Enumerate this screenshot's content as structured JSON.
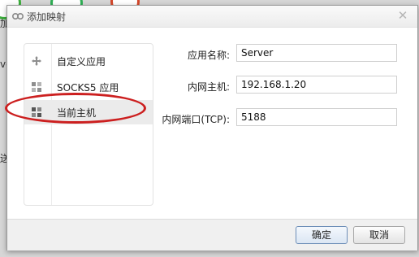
{
  "background": {
    "edge_text_1": "加",
    "edge_text_2": "ve",
    "edge_text_3": "送"
  },
  "dialog": {
    "title": "添加映射",
    "close_icon": "close-icon"
  },
  "sidebar": {
    "items": [
      {
        "label": "自定义应用",
        "icon": "move-arrows-icon",
        "selected": false
      },
      {
        "label": "SOCKS5 应用",
        "icon": "grid-icon",
        "selected": false
      },
      {
        "label": "当前主机",
        "icon": "grid-icon",
        "selected": true
      }
    ]
  },
  "form": {
    "app_name_label": "应用名称:",
    "app_name_value": "Server",
    "host_label": "内网主机:",
    "host_value": "192.168.1.20",
    "port_label": "内网端口(TCP):",
    "port_value": "5188"
  },
  "footer": {
    "ok_label": "确定",
    "cancel_label": "取消"
  },
  "colors": {
    "highlight_ellipse": "#cc1f1f",
    "selected_row": "#ebebeb"
  }
}
